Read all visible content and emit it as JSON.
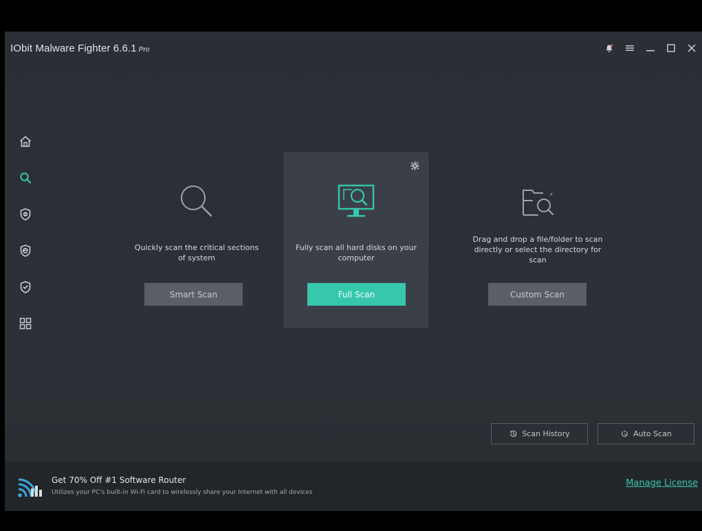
{
  "window": {
    "title": "IObit Malware Fighter 6.6.1",
    "edition": "Pro"
  },
  "title_controls": [
    "bell-icon",
    "menu-icon",
    "minimize-icon",
    "maximize-icon",
    "close-icon"
  ],
  "sidebar": {
    "items": [
      {
        "name": "home",
        "icon": "home-icon",
        "active": false
      },
      {
        "name": "scan",
        "icon": "search-icon",
        "active": true
      },
      {
        "name": "protection",
        "icon": "shield-icon",
        "active": false
      },
      {
        "name": "browser-protection",
        "icon": "browser-shield-icon",
        "active": false
      },
      {
        "name": "action-center",
        "icon": "check-shield-icon",
        "active": false
      },
      {
        "name": "more",
        "icon": "grid-icon",
        "active": false
      }
    ]
  },
  "scans": {
    "smart": {
      "description": "Quickly scan the critical sections of system",
      "button": "Smart Scan"
    },
    "full": {
      "description": "Fully scan all hard disks on your computer",
      "button": "Full Scan"
    },
    "custom": {
      "description": "Drag and drop a file/folder to scan directly or select the directory for scan",
      "button": "Custom Scan"
    }
  },
  "bottom": {
    "history": "Scan History",
    "auto": "Auto Scan"
  },
  "promo": {
    "title": "Get 70% Off #1 Software Router",
    "subtitle": "Utilizes your PC's built-in Wi-Fi card to wirelessly share your Internet with all devices"
  },
  "manage_license": "Manage License",
  "colors": {
    "accent": "#36c7ad",
    "background": "#2d3137",
    "footer": "#22262a"
  }
}
